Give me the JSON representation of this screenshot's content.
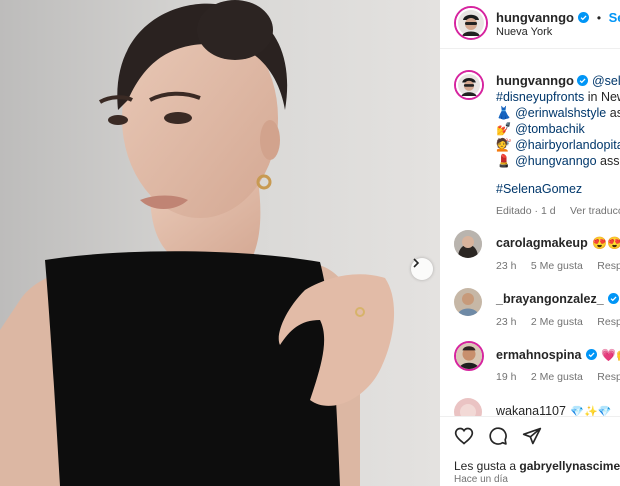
{
  "header": {
    "username": "hungvanngo",
    "separator": "•",
    "follow_label": "Seguir",
    "location": "Nueva York"
  },
  "caption": {
    "username": "hungvanngo",
    "mention_top": "@selen",
    "hashtag_line_tag": "#disneyupfronts",
    "hashtag_line_rest": " in New",
    "credit1_emoji": "👗",
    "credit1_handle": "@erinwalshstyle",
    "credit1_rest": " ass",
    "credit2_emoji": "💅",
    "credit2_handle": "@tombachik",
    "credit3_emoji": "💇",
    "credit3_handle": "@hairbyorlandopita",
    "credit4_emoji": "💄",
    "credit4_handle": "@hungvanngo",
    "credit4_rest": " assis",
    "hashtag2": "#SelenaGomez",
    "edited": "Editado · 1 d",
    "see_translation": "Ver traducció"
  },
  "comments": [
    {
      "username": "carolagmakeup",
      "emojis": "😍😍",
      "time": "23 h",
      "likes": "5 Me gusta",
      "reply": "Respon",
      "verified": false
    },
    {
      "username": "_brayangonzalez_",
      "emojis": "😍",
      "time": "23 h",
      "likes": "2 Me gusta",
      "reply": "Respon",
      "verified": true
    },
    {
      "username": "ermahnospina",
      "emojis": "💗🙌",
      "time": "19 h",
      "likes": "2 Me gusta",
      "reply": "Respon",
      "verified": true
    },
    {
      "username": "wakana1107",
      "emojis": "💎✨💎",
      "time": "",
      "likes": "",
      "reply": "",
      "verified": false
    }
  ],
  "footer": {
    "likes_prefix": "Les gusta a ",
    "likes_user": "gabryellynasciment",
    "time_ago": "Hace un día"
  },
  "colors": {
    "verified_blue": "#0095f6",
    "follow_blue": "#0095f6",
    "link_blue": "#00376b",
    "text_muted": "#737373"
  },
  "icons": [
    "verified-icon",
    "chevron-right-icon",
    "heart-icon",
    "comment-icon",
    "share-icon"
  ]
}
